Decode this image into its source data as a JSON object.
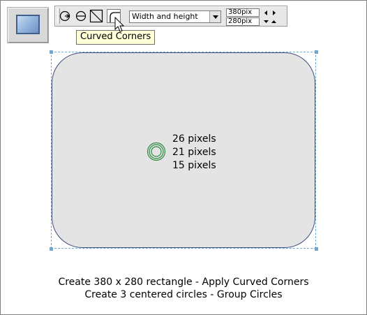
{
  "toolbar": {
    "tool_button_icon": "rectangle-tool-icon",
    "infobar_buttons": [
      {
        "icon": "rotate-circle-icon"
      },
      {
        "icon": "circle-minus-icon"
      },
      {
        "icon": "square-corners-icon"
      },
      {
        "icon": "curved-corners-icon",
        "pressed": true
      }
    ],
    "mode_select_value": "Width and height",
    "width_field": "380pix",
    "height_field": "280pix"
  },
  "tooltip": {
    "text": "Curved Corners"
  },
  "canvas": {
    "rect_fill": "#e4e4e4",
    "circle_color": "#2e8b3e",
    "circle_labels": [
      "26 pixels",
      "21 pixels",
      "15 pixels"
    ]
  },
  "instructions": {
    "line1": "Create 380 x 280 rectangle - Apply Curved Corners",
    "line2": "Create 3 centered circles - Group Circles"
  }
}
